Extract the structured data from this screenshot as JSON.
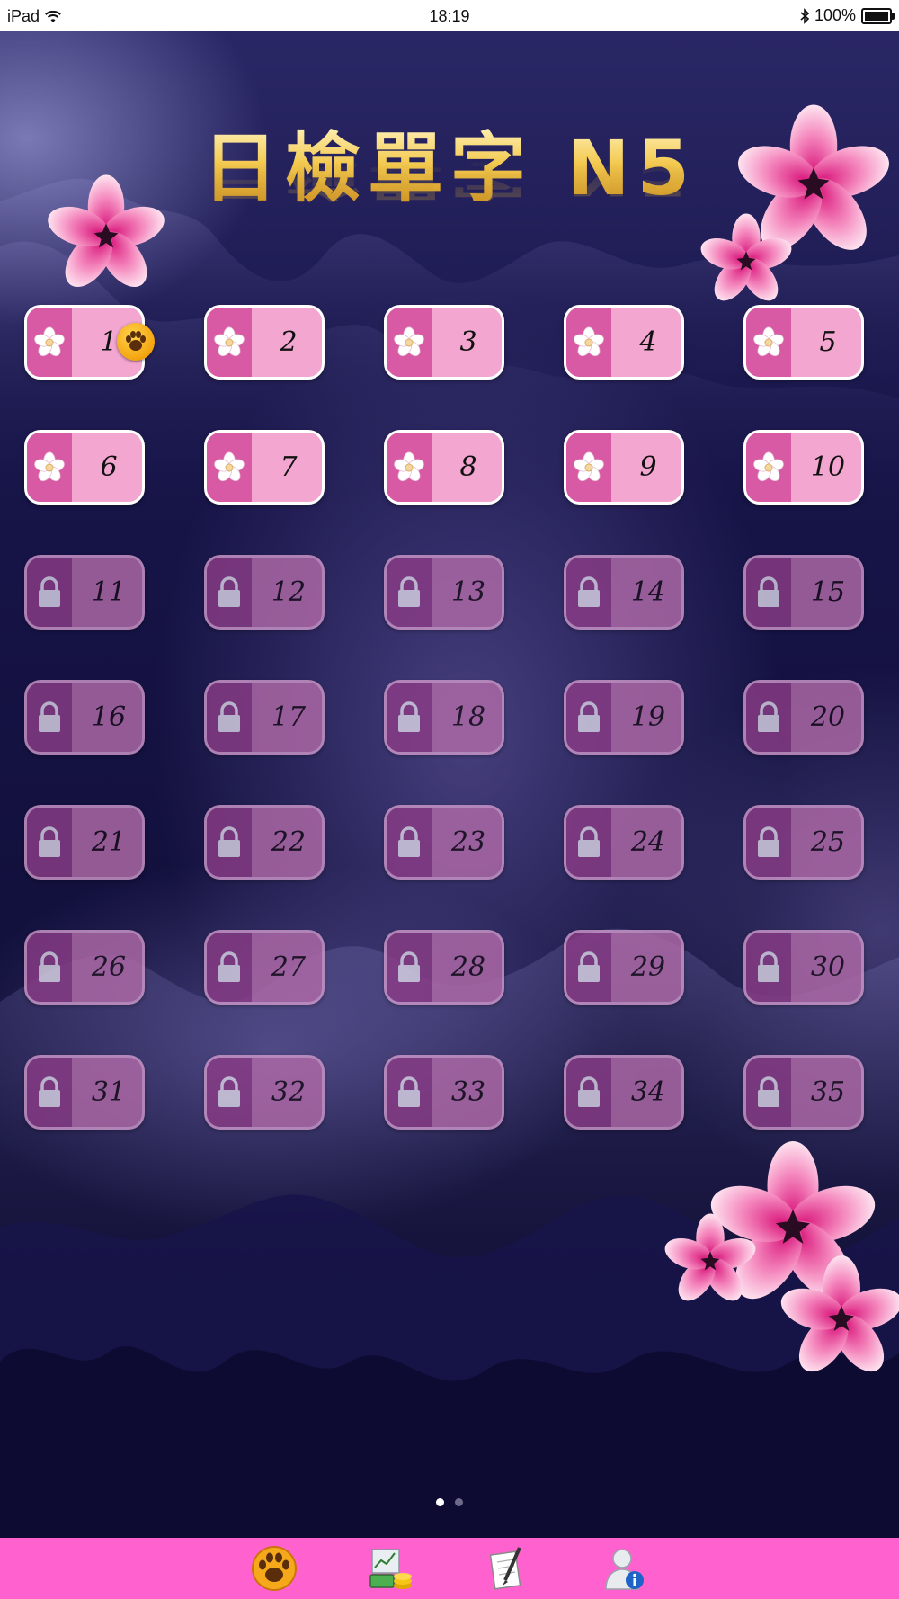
{
  "status_bar": {
    "device": "iPad",
    "time": "18:19",
    "battery": "100%",
    "icons": [
      "wifi-icon",
      "bluetooth-icon",
      "battery-icon"
    ]
  },
  "title": "日檢單字 N5",
  "levels": [
    {
      "n": "1",
      "locked": false
    },
    {
      "n": "2",
      "locked": false
    },
    {
      "n": "3",
      "locked": false
    },
    {
      "n": "4",
      "locked": false
    },
    {
      "n": "5",
      "locked": false
    },
    {
      "n": "6",
      "locked": false
    },
    {
      "n": "7",
      "locked": false
    },
    {
      "n": "8",
      "locked": false
    },
    {
      "n": "9",
      "locked": false
    },
    {
      "n": "10",
      "locked": false
    },
    {
      "n": "11",
      "locked": true
    },
    {
      "n": "12",
      "locked": true
    },
    {
      "n": "13",
      "locked": true
    },
    {
      "n": "14",
      "locked": true
    },
    {
      "n": "15",
      "locked": true
    },
    {
      "n": "16",
      "locked": true
    },
    {
      "n": "17",
      "locked": true
    },
    {
      "n": "18",
      "locked": true
    },
    {
      "n": "19",
      "locked": true
    },
    {
      "n": "20",
      "locked": true
    },
    {
      "n": "21",
      "locked": true
    },
    {
      "n": "22",
      "locked": true
    },
    {
      "n": "23",
      "locked": true
    },
    {
      "n": "24",
      "locked": true
    },
    {
      "n": "25",
      "locked": true
    },
    {
      "n": "26",
      "locked": true
    },
    {
      "n": "27",
      "locked": true
    },
    {
      "n": "28",
      "locked": true
    },
    {
      "n": "29",
      "locked": true
    },
    {
      "n": "30",
      "locked": true
    },
    {
      "n": "31",
      "locked": true
    },
    {
      "n": "32",
      "locked": true
    },
    {
      "n": "33",
      "locked": true
    },
    {
      "n": "34",
      "locked": true
    },
    {
      "n": "35",
      "locked": true
    }
  ],
  "current_level": "1",
  "page_indicator": {
    "pages": 2,
    "current": 1
  },
  "tab_bar": {
    "tabs": [
      {
        "name": "paw",
        "icon": "paw-icon"
      },
      {
        "name": "stats",
        "icon": "chart-coins-icon"
      },
      {
        "name": "notes",
        "icon": "notepad-pen-icon"
      },
      {
        "name": "info",
        "icon": "user-info-icon"
      }
    ]
  },
  "colors": {
    "tab_bar": "#ff62cf",
    "level_unlocked": "#f3a6cf",
    "level_unlocked_side": "#d85aa4",
    "level_locked": "#b06aa8",
    "title_gold": "#f0c64c",
    "background": "#12103c"
  }
}
